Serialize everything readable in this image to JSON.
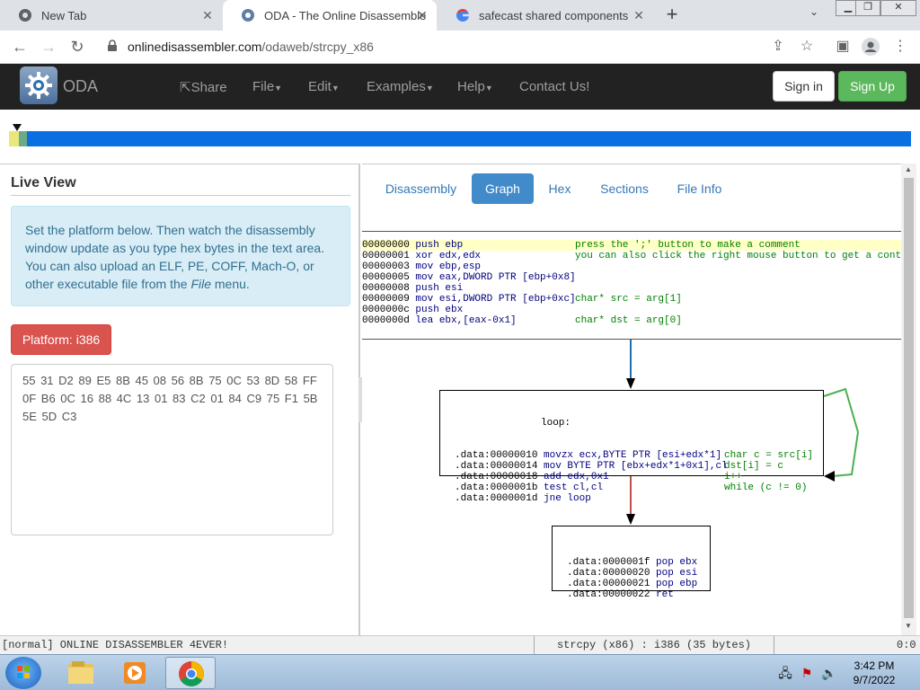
{
  "browser": {
    "tabs": [
      {
        "title": "New Tab",
        "icon": "chrome-icon"
      },
      {
        "title": "ODA - The Online Disassembler",
        "icon": "oda-icon"
      },
      {
        "title": "safecast shared components - Go",
        "icon": "google-icon"
      }
    ],
    "url_host": "onlinedisassembler.com",
    "url_path": "/odaweb/strcpy_x86"
  },
  "oda_nav": {
    "brand": "ODA",
    "links": [
      "Share",
      "File",
      "Edit",
      "Examples",
      "Help",
      "Contact Us!"
    ],
    "signin": "Sign in",
    "signup": "Sign Up"
  },
  "live_view": {
    "title": "Live View",
    "info_pre": "Set the platform below. Then watch the disassembly window update as you type hex bytes in the text area. You can also upload an ELF, PE, COFF, Mach-O, or other executable file from the ",
    "info_em": "File",
    "info_post": " menu.",
    "platform_button": "Platform: i386",
    "hex_bytes": "55 31 D2 89 E5 8B 45 08 56 8B 75 0C 53 8D 58 FF 0F B6 0C 16 88 4C 13 01 83 C2 01 84 C9 75 F1 5B 5E 5D C3"
  },
  "view_tabs": [
    "Disassembly",
    "Graph",
    "Hex",
    "Sections",
    "File Info"
  ],
  "active_tab": "Graph",
  "listing": [
    {
      "addr": "00000000",
      "ins": "push ebp",
      "comment": "press the ';' button to make a comment",
      "hl": true
    },
    {
      "addr": "00000001",
      "ins": "xor edx,edx",
      "comment": "you can also click the right mouse button to get a context menu"
    },
    {
      "addr": "00000003",
      "ins": "mov ebp,esp",
      "comment": ""
    },
    {
      "addr": "00000005",
      "ins": "mov eax,DWORD PTR [ebp+0x8]",
      "comment": ""
    },
    {
      "addr": "00000008",
      "ins": "push esi",
      "comment": ""
    },
    {
      "addr": "00000009",
      "ins": "mov esi,DWORD PTR [ebp+0xc]",
      "comment": "char* src = arg[1]"
    },
    {
      "addr": "0000000c",
      "ins": "push ebx",
      "comment": ""
    },
    {
      "addr": "0000000d",
      "ins": "lea ebx,[eax-0x1]",
      "comment": "char* dst = arg[0]"
    }
  ],
  "graph": {
    "loop_label": "loop:",
    "loop_block": [
      {
        "addr": ".data:00000010",
        "ins": "movzx ecx,BYTE PTR [esi+edx*1]",
        "comment": "char c = src[i]"
      },
      {
        "addr": ".data:00000014",
        "ins": "mov BYTE PTR [ebx+edx*1+0x1],cl",
        "comment": "dst[i] = c"
      },
      {
        "addr": ".data:00000018",
        "ins": "add edx,0x1",
        "comment": "i++"
      },
      {
        "addr": ".data:0000001b",
        "ins": "test cl,cl",
        "comment": "while (c != 0)"
      },
      {
        "addr": ".data:0000001d",
        "ins": "jne loop",
        "comment": ""
      }
    ],
    "exit_block": [
      {
        "addr": ".data:0000001f",
        "ins": "pop ebx"
      },
      {
        "addr": ".data:00000020",
        "ins": "pop esi"
      },
      {
        "addr": ".data:00000021",
        "ins": "pop ebp"
      },
      {
        "addr": ".data:00000022",
        "ins": "ret"
      }
    ],
    "edge_colors": {
      "entry": "#1f6fb0",
      "false": "#c0504d",
      "back": "#4caf50"
    }
  },
  "status": {
    "left": "[normal] ONLINE DISASSEMBLER 4EVER!",
    "center": "strcpy (x86) : i386 (35 bytes)",
    "right": "0:0"
  },
  "taskbar": {
    "time": "3:42 PM",
    "date": "9/7/2022"
  }
}
